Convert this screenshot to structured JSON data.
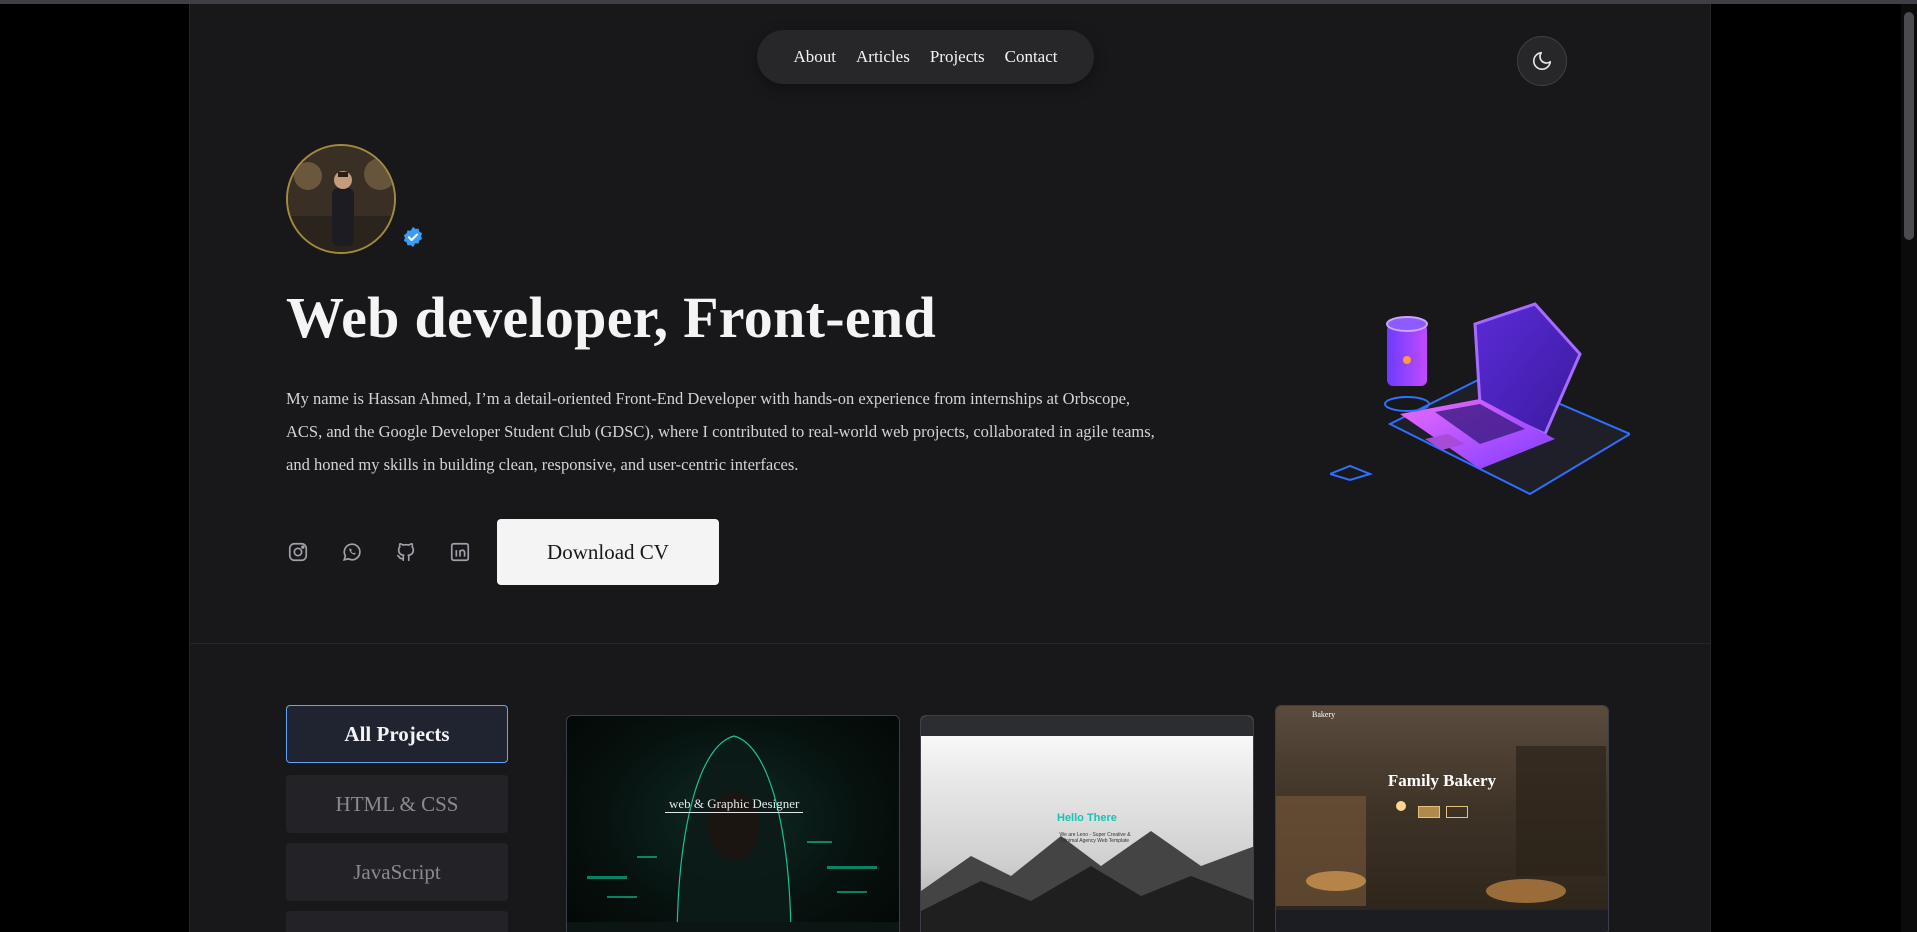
{
  "nav": {
    "items": [
      "About",
      "Articles",
      "Projects",
      "Contact"
    ]
  },
  "theme_toggle": {
    "icon": "moon-icon"
  },
  "hero": {
    "title": "Web developer, Front-end",
    "description": "My name is Hassan Ahmed, I’m a detail-oriented Front-End Developer with hands-on experience from internships at Orbscope, ACS, and the Google Developer Student Club (GDSC), where I contributed to real-world web projects, collaborated in agile teams, and honed my skills in building clean, responsive, and user-centric interfaces.",
    "download_label": "Download CV",
    "socials": [
      "instagram-icon",
      "whatsapp-icon",
      "github-icon",
      "linkedin-icon"
    ]
  },
  "filters": {
    "items": [
      "All Projects",
      "HTML & CSS",
      "JavaScript"
    ],
    "active": "All Projects"
  },
  "projects": {
    "card1": {
      "title": "web & Graphic Designer"
    },
    "card2": {
      "title": "Hello There",
      "subtitle": "We are Leno - Super Creative & Minimal Agency Web Template"
    },
    "card3": {
      "title": "Family Bakery",
      "logo": "Bakery"
    }
  },
  "colors": {
    "page_bg": "#18181b",
    "accent": "#60a5fa",
    "text": "#f4f4f5"
  }
}
